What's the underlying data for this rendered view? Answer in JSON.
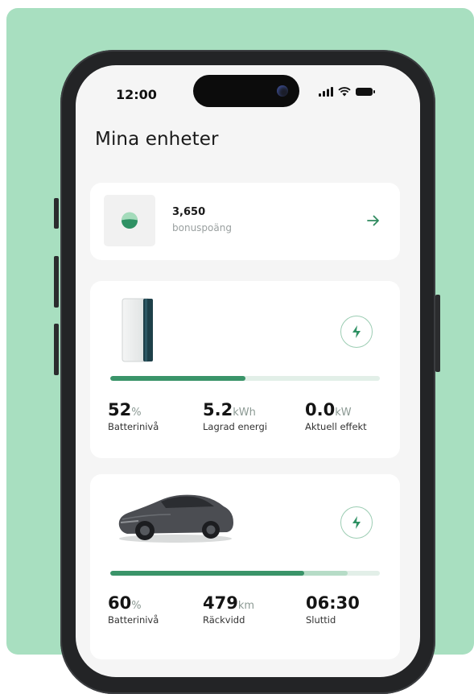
{
  "status_bar": {
    "time": "12:00"
  },
  "page": {
    "title": "Mina enheter"
  },
  "bonus": {
    "amount": "3,650",
    "label": "bonuspoäng"
  },
  "home_battery": {
    "level_fraction": 0.5,
    "stats": [
      {
        "value": "52",
        "unit": "%",
        "label": "Batterinivå"
      },
      {
        "value": "5.2",
        "unit": "kWh",
        "label": "Lagrad energi"
      },
      {
        "value": "0.0",
        "unit": "kW",
        "label": "Aktuell effekt"
      }
    ]
  },
  "car": {
    "level_fraction": 0.72,
    "target_fraction": 0.88,
    "stats": [
      {
        "value": "60",
        "unit": "%",
        "label": "Batterinivå"
      },
      {
        "value": "479",
        "unit": "km",
        "label": "Räckvidd"
      },
      {
        "value": "06:30",
        "unit": "",
        "label": "Sluttid"
      }
    ]
  },
  "colors": {
    "background": "#a8dfc0",
    "accent": "#3a9469",
    "accent_light": "#b6dcc7",
    "screen": "#f5f5f5"
  },
  "icons": [
    "signal-icon",
    "wifi-icon",
    "battery-icon",
    "bonus-coin-icon",
    "arrow-right-icon",
    "lightning-icon",
    "home-battery-image",
    "car-image"
  ]
}
